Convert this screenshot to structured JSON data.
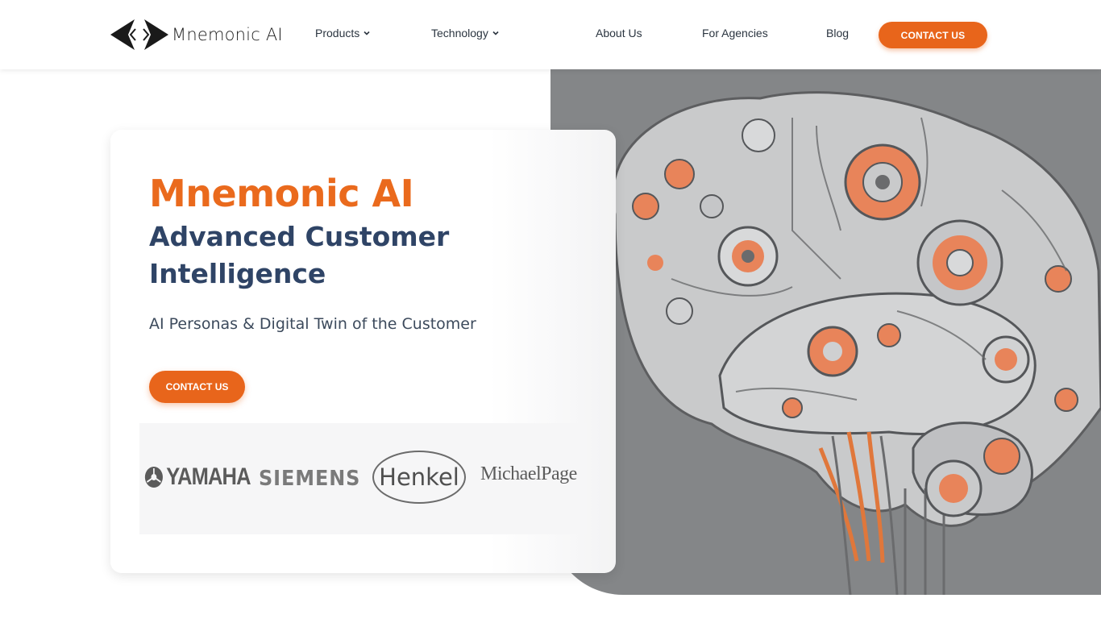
{
  "brand": {
    "name": "Mnemonic AI",
    "logo_icon": "chevrons-diamond-logo-icon"
  },
  "nav": {
    "items": [
      {
        "label": "Products",
        "has_dropdown": true
      },
      {
        "label": "Technology",
        "has_dropdown": true
      },
      {
        "label": "About Us",
        "has_dropdown": false
      },
      {
        "label": "For Agencies",
        "has_dropdown": false
      },
      {
        "label": "Blog",
        "has_dropdown": false
      }
    ],
    "cta_label": "CONTACT US"
  },
  "hero": {
    "title": "Mnemonic AI",
    "subtitle": "Advanced Customer Intelligence",
    "tagline": "AI Personas & Digital Twin of the Customer",
    "cta_label": "CONTACT US",
    "image": "mechanical-brain-illustration"
  },
  "clients": [
    {
      "name": "YAMAHA",
      "icon": "tuning-forks-logo-icon"
    },
    {
      "name": "SIEMENS"
    },
    {
      "name": "Henkel"
    },
    {
      "name": "MichaelPage"
    }
  ],
  "colors": {
    "accent": "#e8651b",
    "title_orange": "#ea6a1d",
    "navy": "#2f4466",
    "image_bg": "#848688",
    "nav_text": "#2b3540"
  }
}
